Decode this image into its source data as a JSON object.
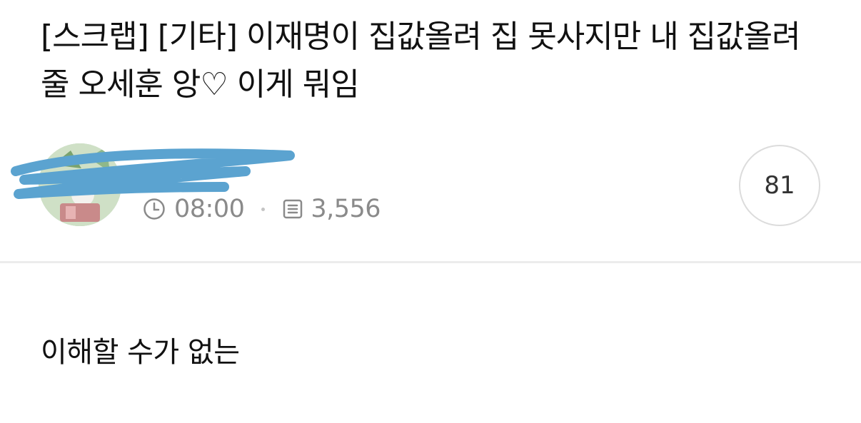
{
  "post": {
    "title": "[스크랩] [기타] 이재명이 집값올려 집 못사지만 내 집값올려줄 오세훈 앙♡ 이게 뭐임",
    "time": "08:00",
    "views": "3,556",
    "comment_count": "81",
    "body": "이해할 수가 없는"
  },
  "icons": {
    "time": "clock-icon",
    "views": "document-icon"
  },
  "colors": {
    "scribble": "#5ba3d0",
    "meta_text": "#8a8a8a",
    "divider": "#ececec"
  }
}
